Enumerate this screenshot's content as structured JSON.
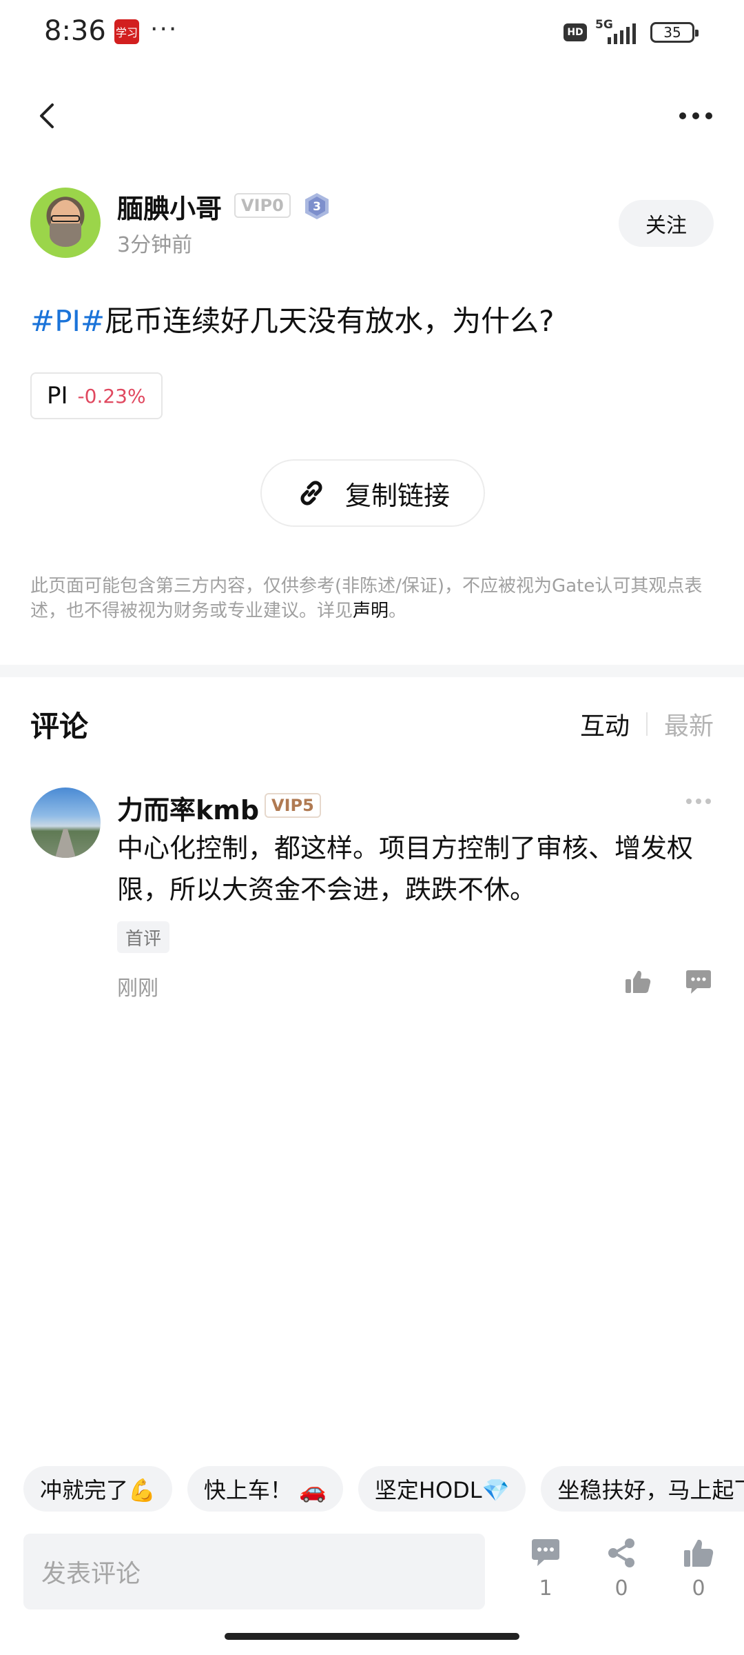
{
  "status_bar": {
    "time": "8:36",
    "app_badge": "学习",
    "overflow": "···",
    "hd": "HD",
    "network": "5G",
    "battery": "35"
  },
  "nav": {
    "back_icon": "back-chevron-icon",
    "more_icon": "more-dots-icon"
  },
  "author": {
    "name": "腼腆小哥",
    "vip": "VIP0",
    "level": "3",
    "time": "3分钟前",
    "follow_label": "关注"
  },
  "post": {
    "hashtag": "#PI#",
    "body": "屁币连续好几天没有放水，为什么?",
    "token_symbol": "PI",
    "token_change": "-0.23%",
    "copy_link_label": "复制链接"
  },
  "disclaimer": {
    "text": "此页面可能包含第三方内容，仅供参考(非陈述/保证)，不应被视为Gate认可其观点表述，也不得被视为财务或专业建议。详见",
    "link": "声明",
    "end": "。"
  },
  "comments": {
    "title": "评论",
    "sort_active": "互动",
    "sort_other": "最新",
    "items": [
      {
        "name": "力而率kmb",
        "vip": "VIP5",
        "text": "中心化控制，都这样。项目方控制了审核、增发权限，所以大资金不会进，跌跌不休。",
        "tag": "首评",
        "time": "刚刚"
      }
    ]
  },
  "quick_replies": [
    "冲就完了💪",
    "快上车！ 🚗",
    "坚定HODL💎",
    "坐稳扶好，马上起飞"
  ],
  "bottom_bar": {
    "input_placeholder": "发表评论",
    "comment_count": "1",
    "share_count": "0",
    "like_count": "0"
  },
  "colors": {
    "hashtag": "#1a73d9",
    "negative": "#e0485f",
    "vip5": "#b07a52"
  }
}
